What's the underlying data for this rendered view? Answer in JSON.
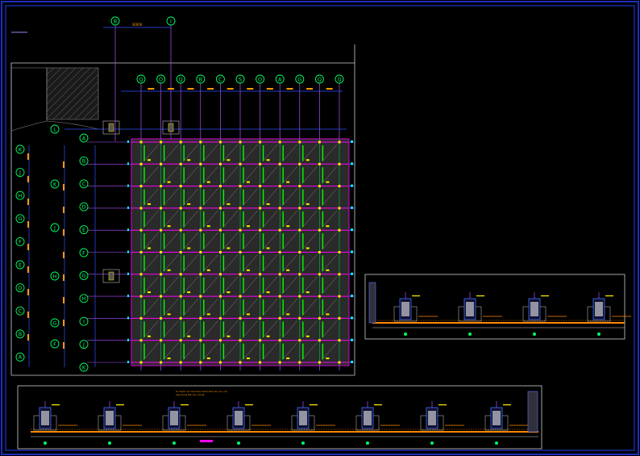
{
  "drawing": {
    "colors": {
      "background": "#000000",
      "border": "#2a3cff",
      "grid_line": "#b050ff",
      "bubble": "#00ff66",
      "dim_line": "#3050ff",
      "dim_text": "#ff9900",
      "column": "#ffee00",
      "beam": "#ff00ff",
      "slab_fill": "#2a2a2a",
      "hatch": "#ffffff",
      "rebar_green": "#00ff00",
      "cyan_mark": "#00ffff",
      "foundation_orange": "#ff8800"
    },
    "plan": {
      "top_axes_upper": [
        "B",
        "I"
      ],
      "top_axes": [
        "Q",
        "O",
        "Q",
        "B",
        "C",
        "S",
        "O",
        "A",
        "G",
        "Q",
        "Q"
      ],
      "left_axes_outer": [
        "K",
        "J",
        "H",
        "G",
        "F",
        "E",
        "D",
        "C",
        "B",
        "A"
      ],
      "left_axes_mid": [
        "L",
        "K",
        "J",
        "H",
        "G",
        "F"
      ],
      "left_axes_inner": [
        "A",
        "B",
        "C",
        "D",
        "E",
        "F",
        "G",
        "H",
        "I",
        "J",
        "K"
      ],
      "top_dimension": "36000"
    },
    "section_right": {
      "column_count": 4
    },
    "section_bottom": {
      "column_count": 8,
      "note_line_1": "Xi mach noi ma tran mach khoi bo cuu coc",
      "note_line_2": "xay dung ket cau mong"
    }
  }
}
